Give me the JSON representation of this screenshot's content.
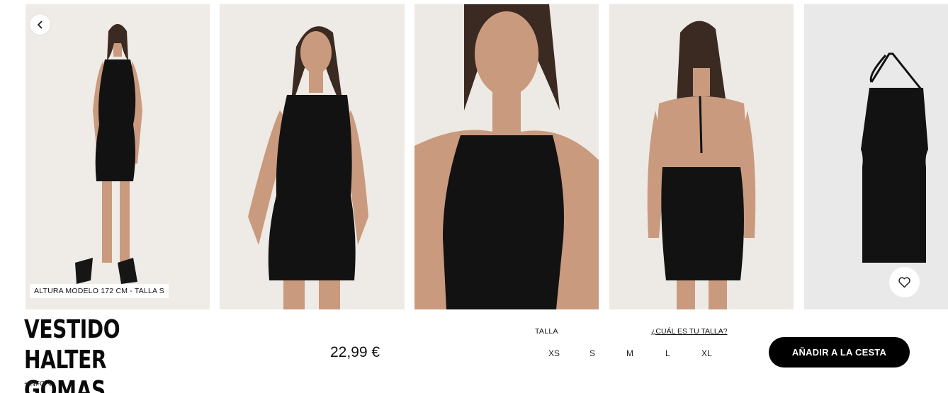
{
  "gallery": {
    "model_tag": "ALTURA MODELO 172 CM - TALLA S",
    "photos": [
      {
        "name": "Modelo frontal cuerpo entero"
      },
      {
        "name": "Modelo plano medio"
      },
      {
        "name": "Detalle escote halter"
      },
      {
        "name": "Espalda descubierta"
      },
      {
        "name": "Prenda sola"
      }
    ]
  },
  "icons": {
    "back": "chevron-left-icon",
    "favorite": "heart-icon",
    "info": "chevron-down-icon"
  },
  "product": {
    "title_line1": "VESTIDO HALTER",
    "title_line2": "GOMAS",
    "info_link": "+INFO",
    "price": "22,99 €"
  },
  "size_selector": {
    "label": "TALLA",
    "guide_link": "¿CUÁL ES TU TALLA?",
    "options": [
      "XS",
      "S",
      "M",
      "L",
      "XL"
    ]
  },
  "cart": {
    "add_label": "AÑADIR A LA CESTA"
  },
  "colors": {
    "accent": "#000000",
    "background": "#ffffff"
  }
}
